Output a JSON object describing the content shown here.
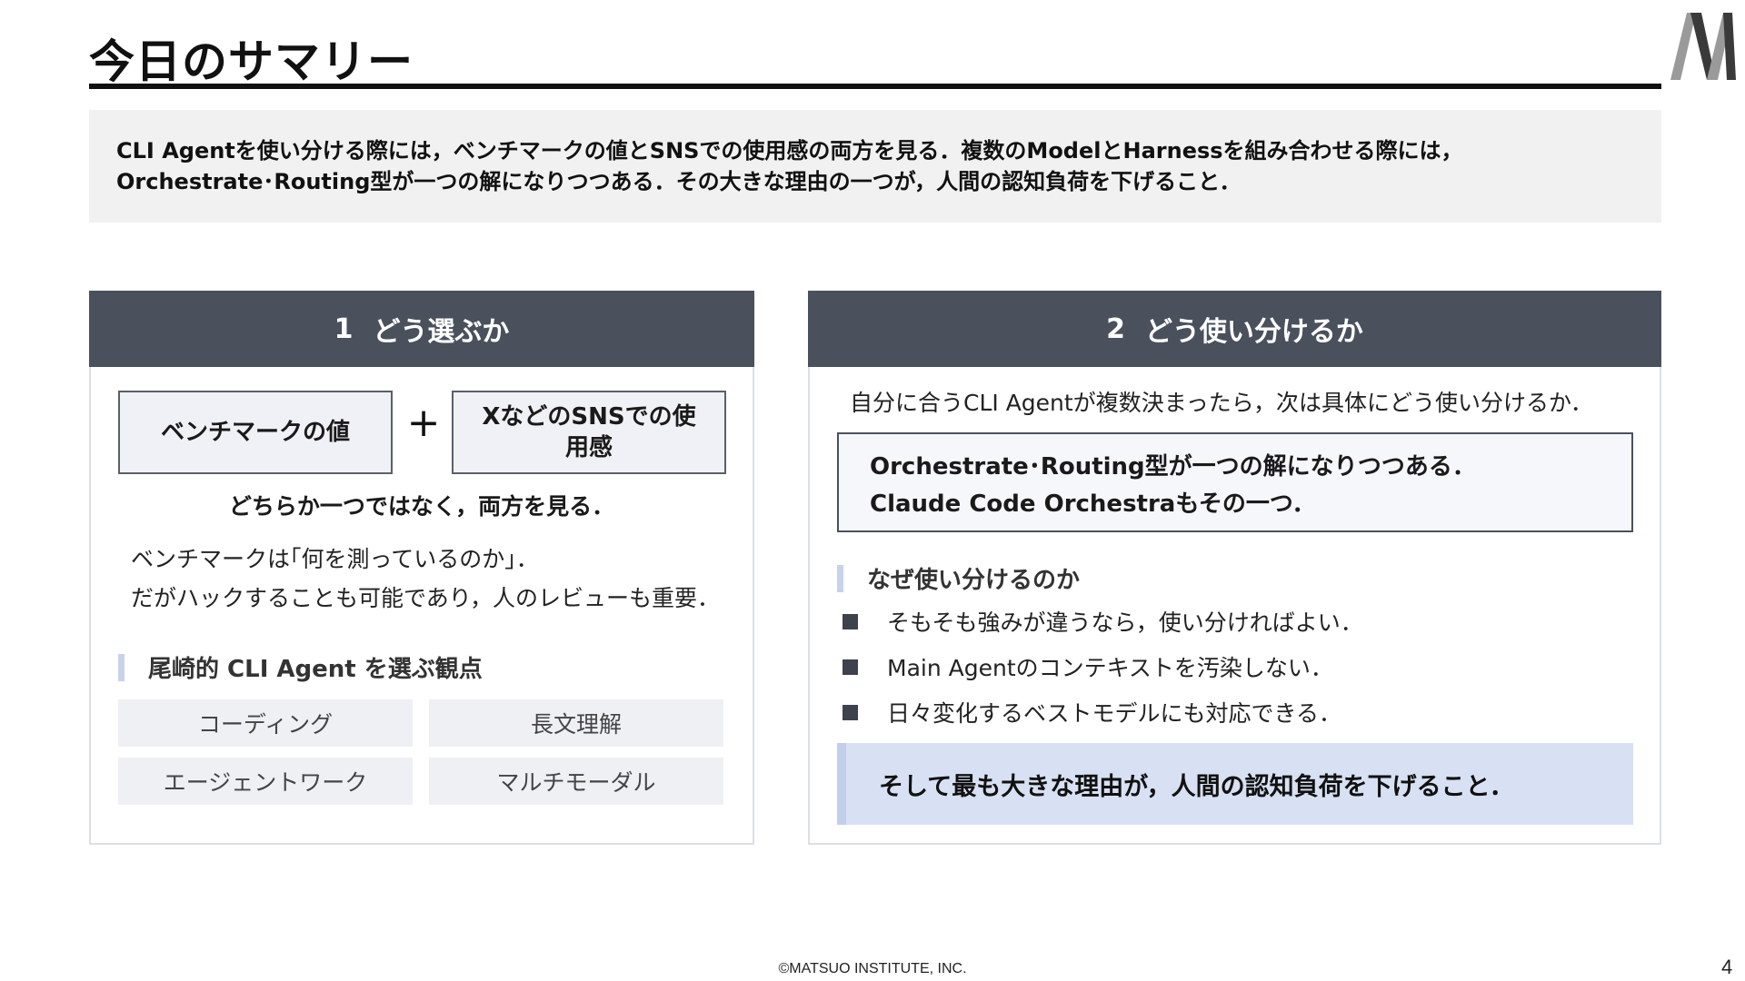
{
  "title": "今日のサマリー",
  "summary": {
    "line1": "CLI Agentを使い分ける際には，ベンチマークの値とSNSでの使用感の両方を見る．複数のModelとHarnessを組み合わせる際には，",
    "line2": "Orchestrate･Routing型が一つの解になりつつある．その大きな理由の一つが，人間の認知負荷を下げること．"
  },
  "left": {
    "num": "1",
    "heading": "どう選ぶか",
    "pill_a": "ベンチマークの値",
    "plus": "+",
    "pill_b_line1": "XなどのSNSでの使",
    "pill_b_line2": "用感",
    "both": "どちらか一つではなく，両方を見る．",
    "bench_line1": "ベンチマークは｢何を測っているのか｣．",
    "bench_line2": "だがハックすることも可能であり，人のレビューも重要．",
    "subhead": "尾崎的 CLI Agent を選ぶ観点",
    "grid": [
      "コーディング",
      "長文理解",
      "エージェントワーク",
      "マルチモーダル"
    ]
  },
  "right": {
    "num": "2",
    "heading": "どう使い分けるか",
    "intro": "自分に合うCLI Agentが複数決まったら，次は具体にどう使い分けるか．",
    "callout_line1": "Orchestrate･Routing型が一つの解になりつつある．",
    "callout_line2": "Claude Code Orchestraもその一つ．",
    "subhead": "なぜ使い分けるのか",
    "bullets": [
      "そもそも強みが違うなら，使い分ければよい．",
      "Main Agentのコンテキストを汚染しない．",
      "日々変化するベストモデルにも対応できる．"
    ],
    "final": "そして最も大きな理由が，人間の認知負荷を下げること．"
  },
  "footer": "©MATSUO INSTITUTE, INC.",
  "page_number": "4",
  "colors": {
    "header_bg": "#4a505c",
    "accent_light": "#d8e1f3",
    "summary_bg": "#f1f1f1"
  }
}
